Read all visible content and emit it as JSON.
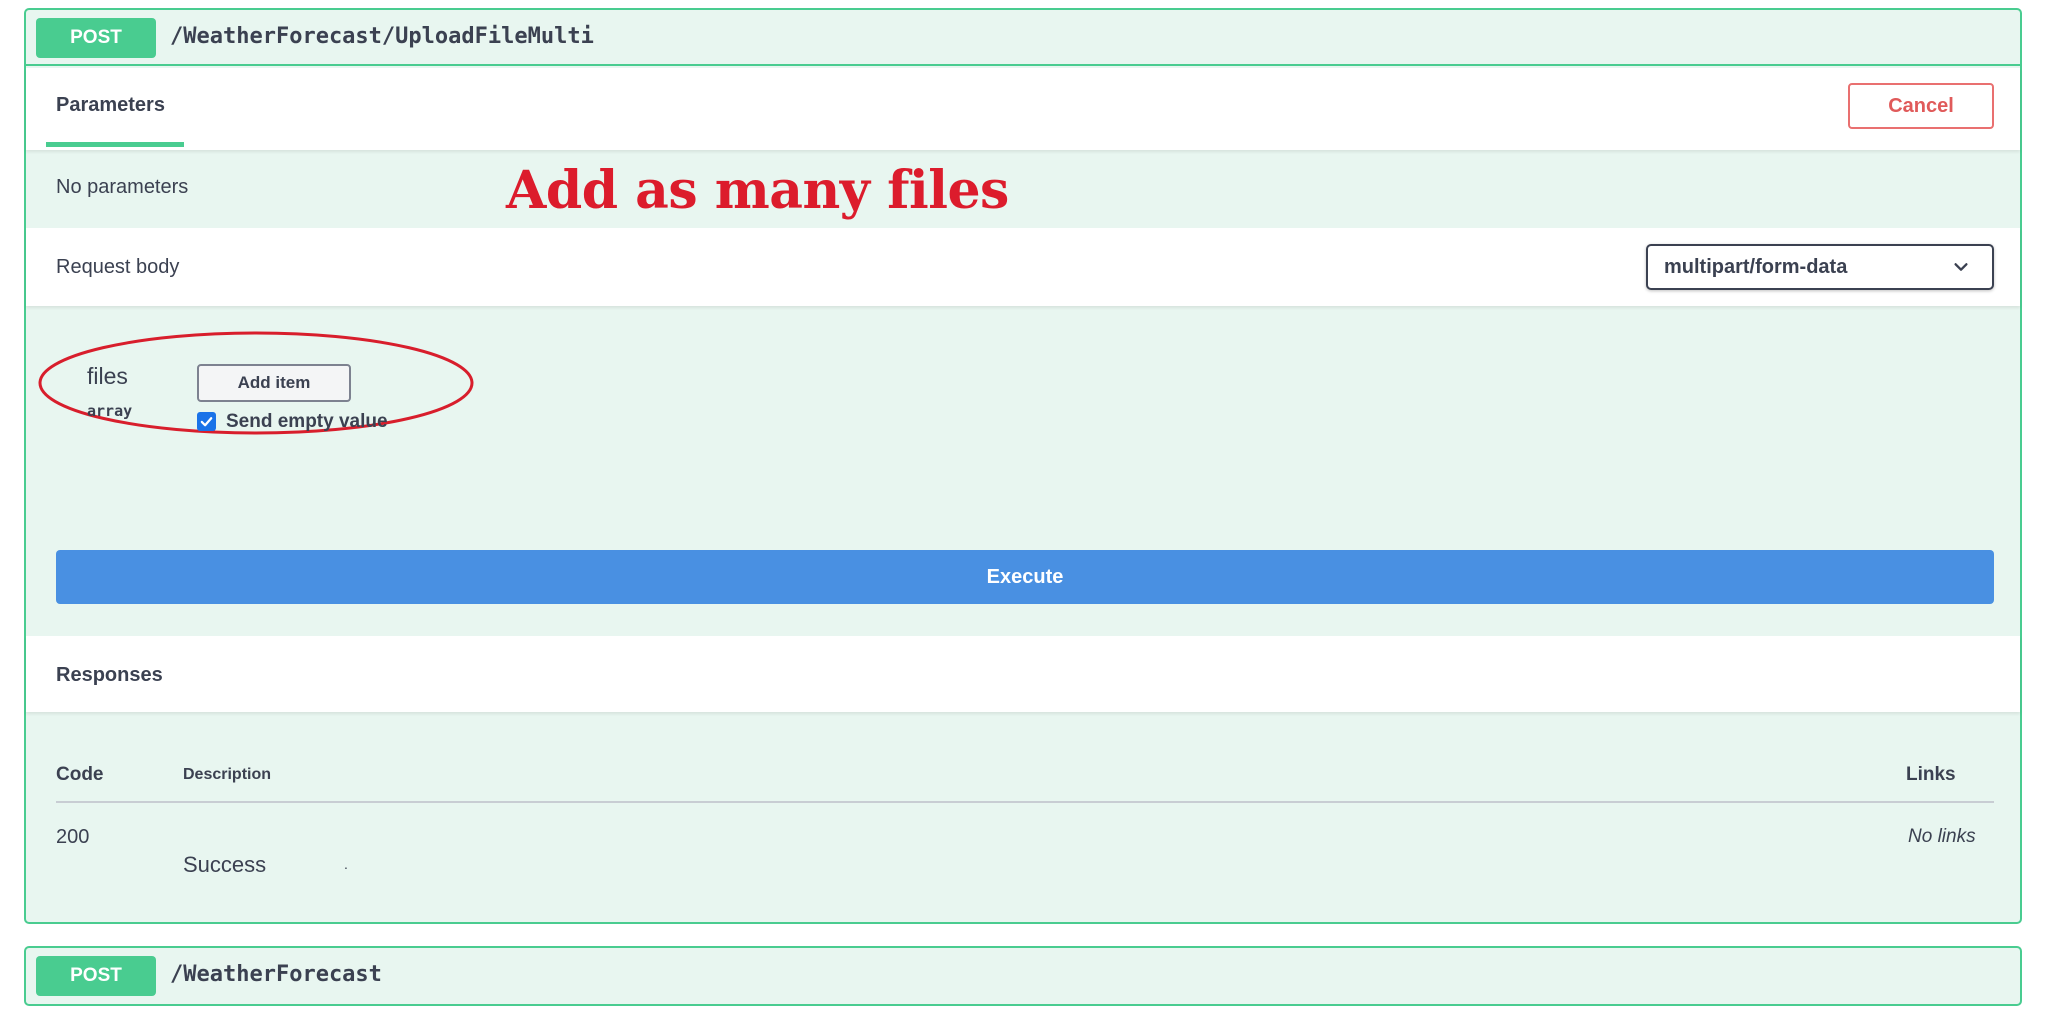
{
  "operations": [
    {
      "method": "POST",
      "path": "/WeatherForecast/UploadFileMulti"
    },
    {
      "method": "POST",
      "path": "/WeatherForecast"
    }
  ],
  "parameters": {
    "tab_label": "Parameters",
    "cancel_label": "Cancel",
    "empty_text": "No parameters"
  },
  "annotation": {
    "text": "Add as many files",
    "color": "#dc1c2c"
  },
  "request_body": {
    "label": "Request body",
    "content_type": "multipart/form-data",
    "field_name": "files",
    "field_type": "array",
    "add_item_label": "Add item",
    "send_empty_label": "Send empty value",
    "send_empty_checked": true
  },
  "execute_label": "Execute",
  "responses": {
    "title": "Responses",
    "headers": {
      "code": "Code",
      "description": "Description",
      "links": "Links"
    },
    "rows": [
      {
        "code": "200",
        "description": "Success",
        "links": "No links"
      }
    ]
  },
  "colors": {
    "post": "#49cc90",
    "execute": "#4990e2",
    "cancel": "#e97070",
    "block_bg": "#e8f6f0"
  }
}
